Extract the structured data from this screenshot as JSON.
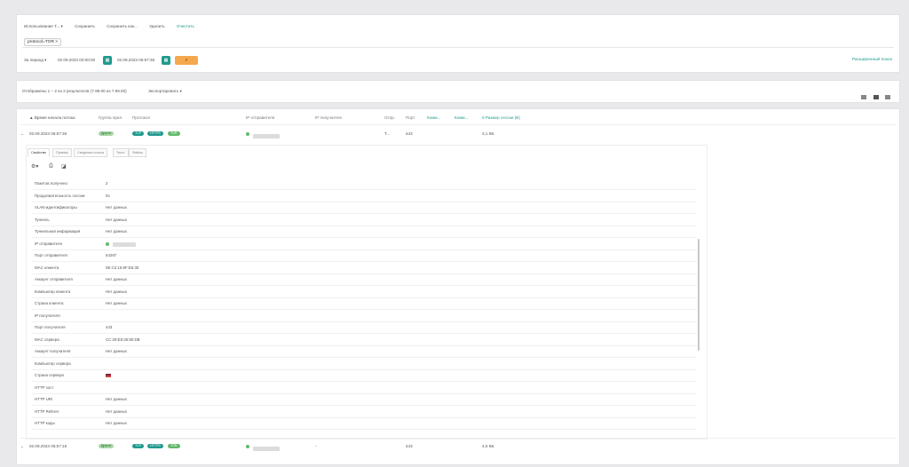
{
  "toolbar": {
    "usage": "Использование Т... ▾",
    "save": "Сохранить",
    "save_as": "Сохранить как...",
    "delete": "Удалить",
    "clear": "Очистить"
  },
  "query": {
    "tag": "protocol=TOR ×"
  },
  "period": {
    "label": "За период ▾",
    "from": "02.09.2023 00:00:00",
    "to": "02.09.2023 06:57:36"
  },
  "advanced_search": "Расширенный поиск",
  "results": {
    "summary": "Отображены 1 – 2 из 2 результатов  (7.99.00 из 7.99.00)",
    "export": "Экспортировать ▾"
  },
  "columns": {
    "start_time": "▲ Время начала потока",
    "group": "Группа прил.",
    "protocol": "Протокол",
    "src_ip": "IP отправителя",
    "dst_ip": "IP получателя",
    "sender": "Отпр.",
    "port": "Порт",
    "comm1": "Комм...",
    "comm2": "Комм...",
    "size": "0 Размер сессии (B)"
  },
  "rows": [
    {
      "time": "02.09.2023 06:57:36",
      "group": "Другое",
      "proto": [
        "TCP",
        "HTTPS",
        "TOR"
      ],
      "port": "443",
      "size": "3,1 КБ",
      "sender": "Т..."
    },
    {
      "time": "02.09.2023 06:57:16",
      "group": "Другое",
      "proto": [
        "TCP",
        "HTTPS",
        "TOR"
      ],
      "port": "443",
      "size": "4,6 КБ",
      "sender": "—"
    }
  ],
  "detail_tabs": [
    "Свойства",
    "Пример",
    "Сведения потока",
    "Текст",
    "Файлы"
  ],
  "properties": [
    {
      "label": "Пакетов получено",
      "value": "2"
    },
    {
      "label": "Продолжительность сессии",
      "value": "0s"
    },
    {
      "label": "VLAN-идентификаторы",
      "value": "Нет данных"
    },
    {
      "label": "Туннель",
      "value": "Нет данных"
    },
    {
      "label": "Туннельная информация",
      "value": "Нет данных"
    },
    {
      "label": "IP отправителя",
      "value": ""
    },
    {
      "label": "Порт отправителя",
      "value": "54297"
    },
    {
      "label": "MAC клиента",
      "value": "0E:C2:15:8F:E5:30"
    },
    {
      "label": "Аккаунт отправителя",
      "value": "Нет данных"
    },
    {
      "label": "Компьютер клиента",
      "value": "Нет данных"
    },
    {
      "label": "Страна клиента",
      "value": "Нет данных"
    },
    {
      "label": "IP получателя",
      "value": ""
    },
    {
      "label": "Порт получателя",
      "value": "443"
    },
    {
      "label": "MAC сервера",
      "value": "CC:29:E8:35:80:DB"
    },
    {
      "label": "Аккаунт получателя",
      "value": "Нет данных"
    },
    {
      "label": "Компьютер сервера",
      "value": ""
    },
    {
      "label": "Страна сервера",
      "value": ""
    },
    {
      "label": "HTTP хост",
      "value": ""
    },
    {
      "label": "HTTP URI",
      "value": "Нет данных"
    },
    {
      "label": "HTTP Referer",
      "value": "Нет данных"
    },
    {
      "label": "HTTP коды",
      "value": "Нет данных"
    }
  ]
}
